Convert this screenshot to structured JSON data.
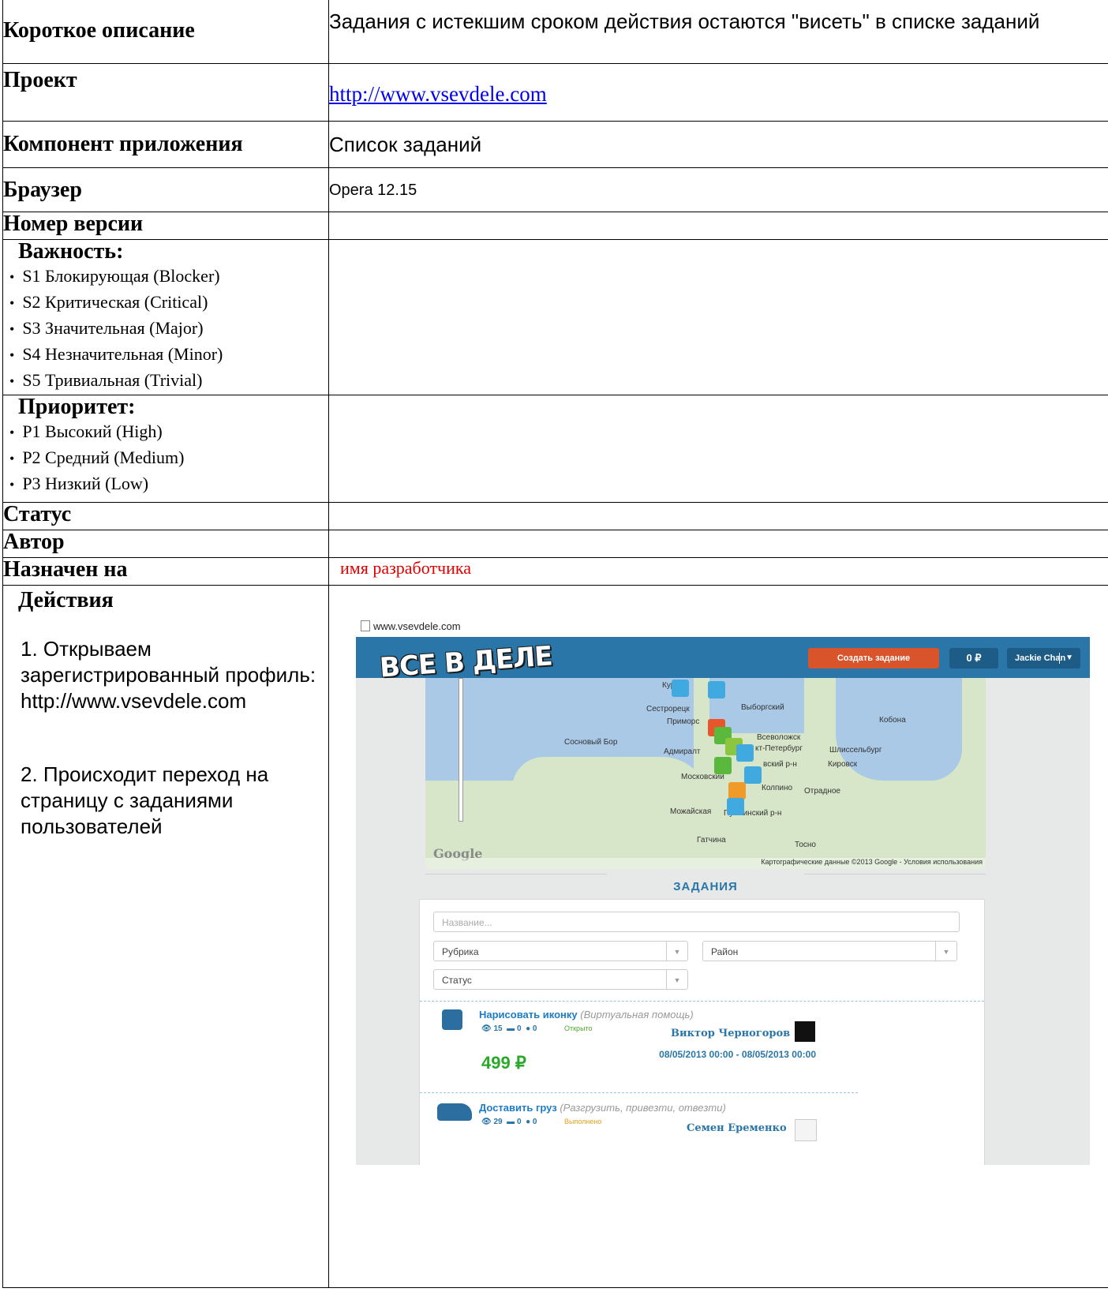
{
  "rows": {
    "short_desc": {
      "label": "Короткое описание",
      "value": "Задания с истекшим сроком действия остаются \"висеть\" в списке заданий"
    },
    "project": {
      "label": "Проект",
      "value": "http://www.vsevdele.com"
    },
    "component": {
      "label": "Компонент приложения",
      "value": "Список заданий"
    },
    "browser": {
      "label": "Браузер",
      "value": "Opera 12.15"
    },
    "version": {
      "label": "Номер версии",
      "value": ""
    },
    "severity": {
      "label": "Важность:",
      "items": [
        "S1 Блокирующая (Blocker)",
        "S2 Критическая (Critical)",
        "S3 Значительная (Major)",
        "S4 Незначительная (Minor)",
        "S5 Тривиальная (Trivial)"
      ]
    },
    "priority": {
      "label": "Приоритет:",
      "items": [
        "P1 Высокий (High)",
        "P2 Средний (Medium)",
        "P3 Низкий (Low)"
      ]
    },
    "status": {
      "label": "Статус",
      "value": ""
    },
    "author": {
      "label": "Автор",
      "value": ""
    },
    "assignee": {
      "label": "Назначен на",
      "value": "имя разработчика"
    },
    "actions": {
      "label": "Действия",
      "steps": [
        "1. Открываем зарегистрированный профиль: http://www.vsevdele.com",
        "2. Происходит переход на страницу с заданиями пользователей"
      ]
    }
  },
  "screenshot": {
    "url": "www.vsevdele.com",
    "logo": "ВСЕ В ДЕЛЕ",
    "create_button": "Создать задание",
    "balance": "0 ₽",
    "user": "Jackie Chan",
    "map_labels": [
      "Курорт",
      "Сестрорецк",
      "Приморс",
      "Выборгский",
      "Всеволожск",
      "кт-Петербург",
      "Шлиссельбург",
      "Кобона",
      "Сосновый Бор",
      "Адмиралт",
      "вский р-н",
      "Кировск",
      "Московский",
      "Колпино",
      "Отрадное",
      "Можайская",
      "Пушкинский р-н",
      "Гатчина",
      "Тосно"
    ],
    "map_footer": "Картографические данные ©2013 Google - Условия использования",
    "google": "Google",
    "section_title": "ЗАДАНИЯ",
    "filters": {
      "name_placeholder": "Название...",
      "category": "Рубрика",
      "district": "Район",
      "status": "Статус"
    },
    "tasks": [
      {
        "title": "Нарисовать иконку",
        "sub": "(Виртуальная помощь)",
        "views": "15",
        "comments": "0",
        "users": "0",
        "state": "Открыто",
        "owner": "Виктор Черногоров",
        "price": "499 ₽",
        "dates": "08/05/2013 00:00 - 08/05/2013 00:00"
      },
      {
        "title": "Доставить груз",
        "sub": "(Разгрузить, привезти, отвезти)",
        "views": "29",
        "comments": "0",
        "users": "0",
        "state": "Выполнено",
        "owner": "Семен Еременко"
      }
    ]
  }
}
